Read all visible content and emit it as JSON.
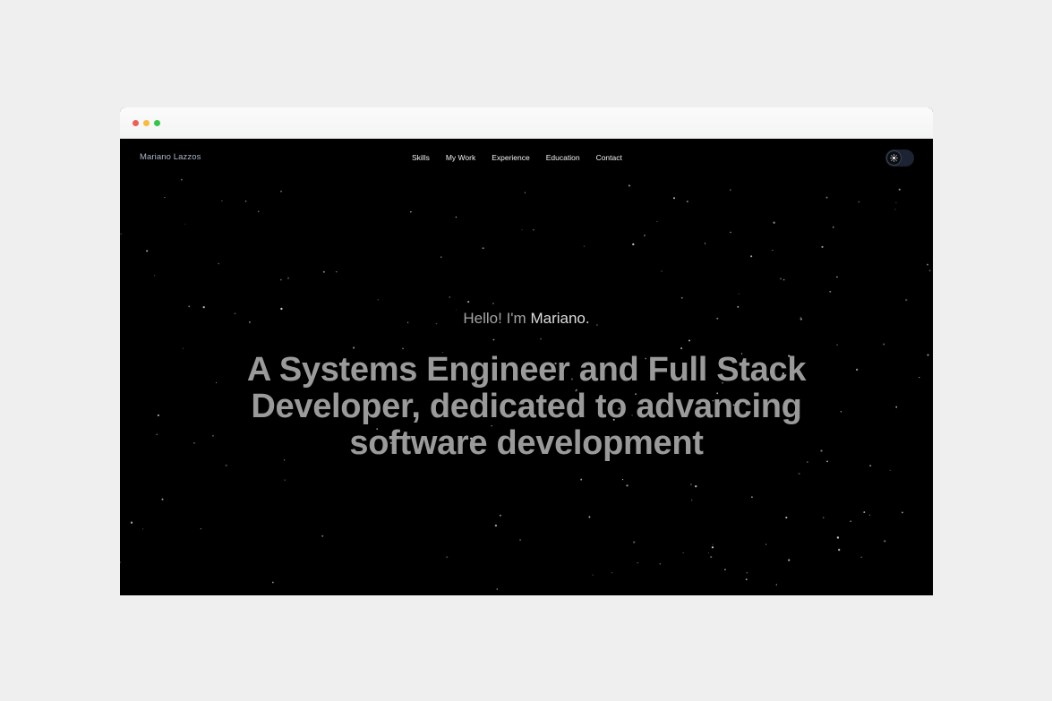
{
  "window": {
    "traffic_lights": {
      "close": "#ee5f57",
      "minimize": "#f6bd3a",
      "maximize": "#33c748"
    }
  },
  "navbar": {
    "brand": "Mariano Lazzos",
    "links": [
      "Skills",
      "My Work",
      "Experience",
      "Education",
      "Contact"
    ],
    "theme_toggle_icon": "sun-icon"
  },
  "hero": {
    "greeting_prefix": "Hello! I'm",
    "greeting_name": "Mariano.",
    "title": "A Systems Engineer and Full Stack Developer, dedicated to advancing software development"
  },
  "colors": {
    "background": "#000000",
    "brand_text": "#aab4c8",
    "nav_text": "#f2f2f2",
    "hero_title": "#9a9a9a",
    "hero_greeting": "#a3a3a3"
  }
}
